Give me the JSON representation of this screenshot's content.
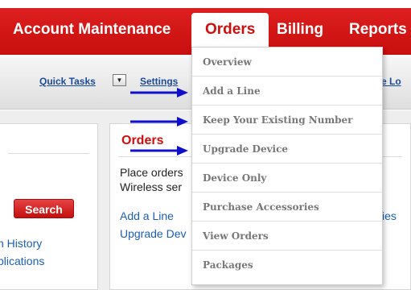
{
  "nav": {
    "tabs": [
      {
        "label": "Account Maintenance"
      },
      {
        "label": "Orders",
        "active": true
      },
      {
        "label": "Billing"
      },
      {
        "label": "Reports"
      }
    ]
  },
  "subnav": {
    "quick_tasks": "Quick Tasks",
    "dropdown_glyph": "▼",
    "settings": "Settings",
    "edge_fragment": "e Lo"
  },
  "orders_menu": {
    "items": [
      {
        "label": "Overview"
      },
      {
        "label": "Add a Line"
      },
      {
        "label": "Keep Your Existing Number"
      },
      {
        "label": "Upgrade Device"
      },
      {
        "label": "Device Only"
      },
      {
        "label": "Purchase Accessories"
      },
      {
        "label": "View Orders"
      },
      {
        "label": "Packages"
      }
    ]
  },
  "left_panel": {
    "search_button": "Search",
    "links": [
      "n History",
      "plications"
    ]
  },
  "orders_panel": {
    "heading": "Orders",
    "description_lines": [
      "Place orders",
      "Wireless ser"
    ],
    "links": [
      "Add a Line",
      "Upgrade Dev"
    ],
    "right_fragment": "ies"
  },
  "colors": {
    "brand_red": "#d10e0e",
    "link_blue": "#1a5fb4",
    "arrow_blue": "#1010cc"
  },
  "icons": {
    "annotation_arrow": "arrow-right-icon"
  }
}
